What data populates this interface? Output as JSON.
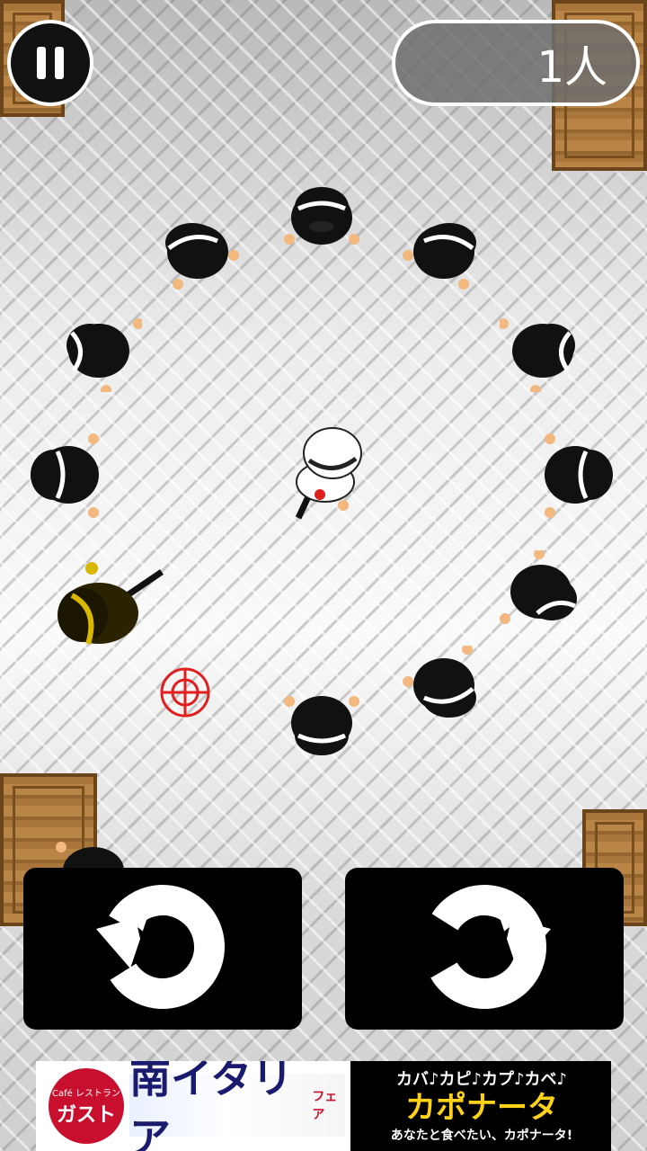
{
  "hud": {
    "counter_text": "1人"
  },
  "icons": {
    "pause": "pause-icon",
    "rotate_left": "rotate-counterclockwise-icon",
    "rotate_right": "rotate-clockwise-icon",
    "target": "crosshair-icon"
  },
  "ad": {
    "brand_small": "Café レストラン",
    "brand_name": "ガスト",
    "fair_title": "南イタリア",
    "fair_tag": "フェア",
    "line1": "カバ♪カピ♪カプ♪カベ♪",
    "line2": "カポナータ",
    "line3": "あなたと食べたい、カポナータ!"
  },
  "colors": {
    "agent_black": "#111111",
    "player_white": "#ffffff",
    "rival_gold": "#d8b800",
    "crosshair_red": "#e02020"
  }
}
